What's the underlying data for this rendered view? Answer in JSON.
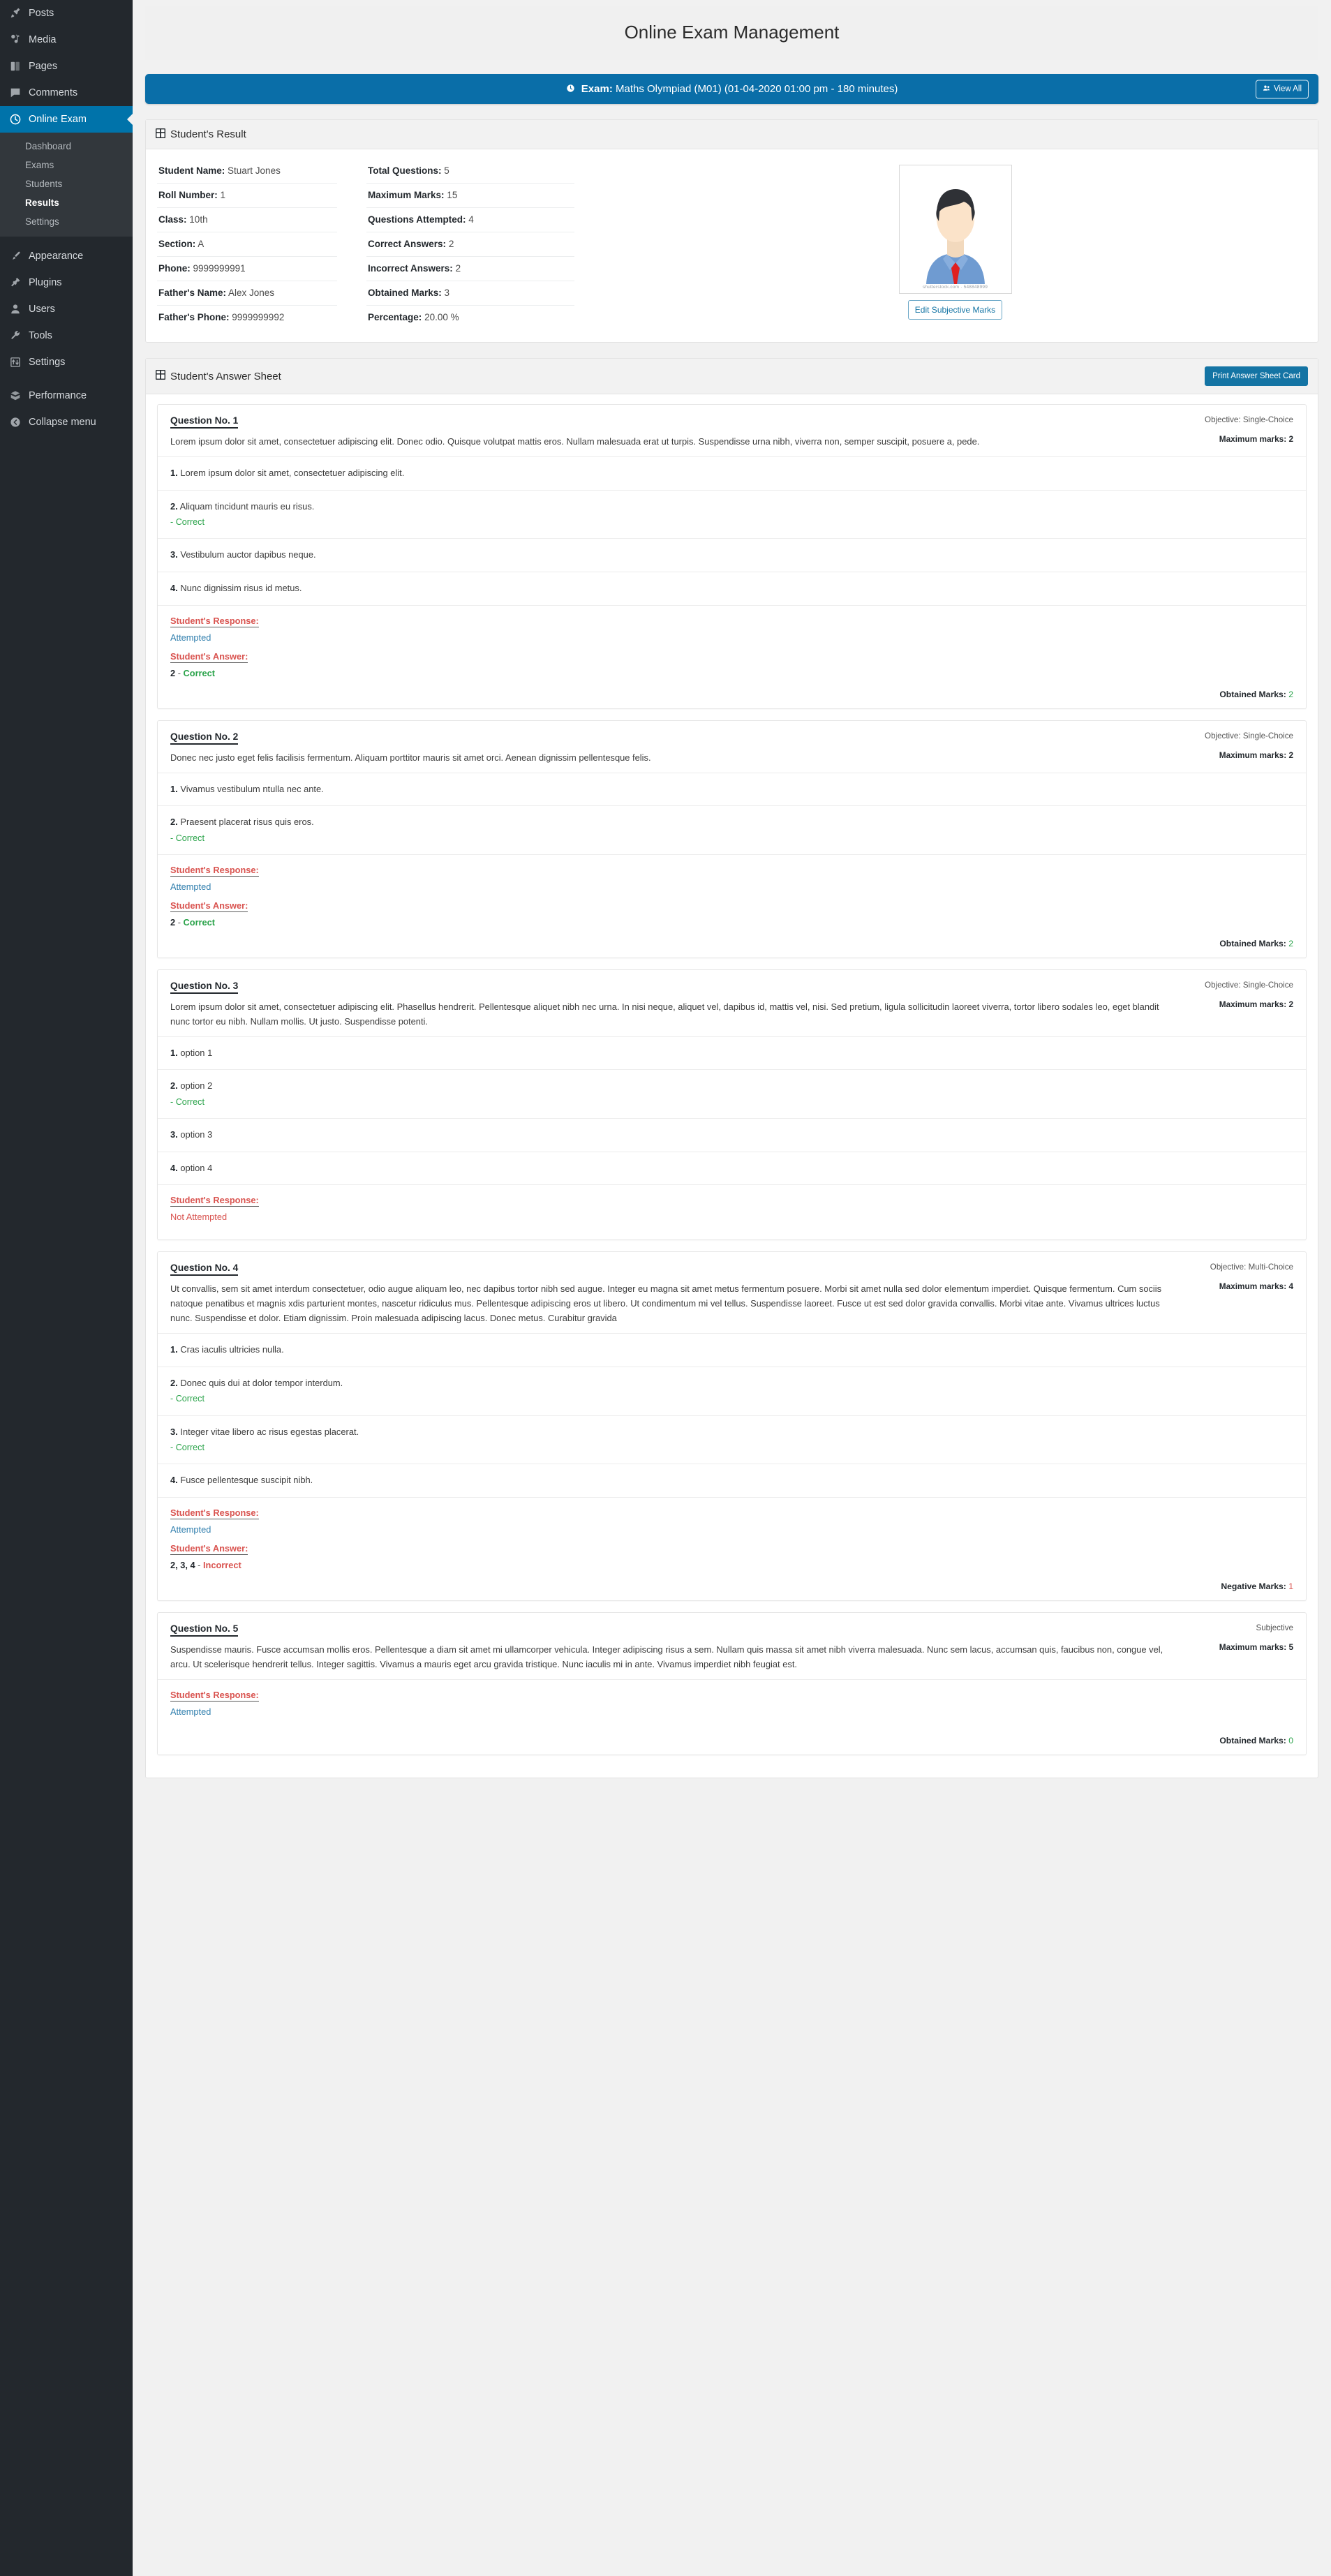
{
  "sidebar": {
    "items": [
      {
        "label": "Posts",
        "icon": "pin-icon"
      },
      {
        "label": "Media",
        "icon": "media-icon"
      },
      {
        "label": "Pages",
        "icon": "pages-icon"
      },
      {
        "label": "Comments",
        "icon": "comments-icon"
      },
      {
        "label": "Online Exam",
        "icon": "clock-icon"
      }
    ],
    "submenu": [
      {
        "label": "Dashboard"
      },
      {
        "label": "Exams"
      },
      {
        "label": "Students"
      },
      {
        "label": "Results"
      },
      {
        "label": "Settings"
      }
    ],
    "active_submenu": "Results",
    "items2": [
      {
        "label": "Appearance",
        "icon": "brush-icon"
      },
      {
        "label": "Plugins",
        "icon": "plug-icon"
      },
      {
        "label": "Users",
        "icon": "user-icon"
      },
      {
        "label": "Tools",
        "icon": "wrench-icon"
      },
      {
        "label": "Settings",
        "icon": "settings-icon"
      }
    ],
    "items3": [
      {
        "label": "Performance",
        "icon": "performance-icon"
      },
      {
        "label": "Collapse menu",
        "icon": "collapse-icon"
      }
    ]
  },
  "page": {
    "title": "Online Exam Management"
  },
  "exam_bar": {
    "label": "Exam:",
    "name": "Maths Olympiad (M01) (01-04-2020 01:00 pm - 180 minutes)",
    "view_all_label": "View All",
    "color": "#0a6ea8"
  },
  "result_panel": {
    "heading": "Student's Result",
    "left": [
      {
        "label": "Student Name:",
        "value": "Stuart Jones"
      },
      {
        "label": "Roll Number:",
        "value": "1"
      },
      {
        "label": "Class:",
        "value": "10th"
      },
      {
        "label": "Section:",
        "value": "A"
      },
      {
        "label": "Phone:",
        "value": "9999999991"
      },
      {
        "label": "Father's Name:",
        "value": "Alex Jones"
      },
      {
        "label": "Father's Phone:",
        "value": "9999999992"
      }
    ],
    "right": [
      {
        "label": "Total Questions:",
        "value": "5"
      },
      {
        "label": "Maximum Marks:",
        "value": "15"
      },
      {
        "label": "Questions Attempted:",
        "value": "4"
      },
      {
        "label": "Correct Answers:",
        "value": "2"
      },
      {
        "label": "Incorrect Answers:",
        "value": "2"
      },
      {
        "label": "Obtained Marks:",
        "value": "3"
      },
      {
        "label": "Percentage:",
        "value": "20.00 %"
      }
    ],
    "photo_watermark": "shutterstock.com · 548848999",
    "edit_subjective_label": "Edit Subjective Marks"
  },
  "answer_sheet": {
    "heading": "Student's Answer Sheet",
    "print_label": "Print Answer Sheet Card",
    "labels": {
      "maximum_marks": "Maximum marks:",
      "obtained_marks": "Obtained Marks:",
      "negative_marks": "Negative Marks:",
      "student_response": "Student's Response:",
      "student_answer": "Student's Answer:",
      "correct": "Correct",
      "dash": "-"
    },
    "questions": [
      {
        "no": "Question No. 1",
        "objective": "Objective: Single-Choice",
        "max_marks_label": "Maximum marks: 2",
        "text": "Lorem ipsum dolor sit amet, consectetuer adipiscing elit. Donec odio. Quisque volutpat mattis eros. Nullam malesuada erat ut turpis. Suspendisse urna nibh, viverra non, semper suscipit, posuere a, pede.",
        "options": [
          {
            "num": "1.",
            "text": "Lorem ipsum dolor sit amet, consectetuer adipiscing elit.",
            "correct": ""
          },
          {
            "num": "2.",
            "text": "Aliquam tincidunt mauris eu risus.",
            "correct": "- Correct"
          },
          {
            "num": "3.",
            "text": "Vestibulum auctor dapibus neque.",
            "correct": ""
          },
          {
            "num": "4.",
            "text": "Nunc dignissim risus id metus.",
            "correct": ""
          }
        ],
        "response_label": "Student's Response:",
        "response_value": "Attempted",
        "response_not_attempted": false,
        "answer_label": "Student's Answer:",
        "answer_value": "2",
        "answer_verdict": "Correct",
        "answer_verdict_type": "correct",
        "footer_label": "Obtained Marks:",
        "footer_value": "2",
        "footer_type": "obtained"
      },
      {
        "no": "Question No. 2",
        "objective": "Objective: Single-Choice",
        "max_marks_label": "Maximum marks: 2",
        "text": "Donec nec justo eget felis facilisis fermentum. Aliquam porttitor mauris sit amet orci. Aenean dignissim pellentesque felis.",
        "options": [
          {
            "num": "1.",
            "text": "Vivamus vestibulum ntulla nec ante.",
            "correct": ""
          },
          {
            "num": "2.",
            "text": "Praesent placerat risus quis eros.",
            "correct": "- Correct"
          }
        ],
        "response_label": "Student's Response:",
        "response_value": "Attempted",
        "response_not_attempted": false,
        "answer_label": "Student's Answer:",
        "answer_value": "2",
        "answer_verdict": "Correct",
        "answer_verdict_type": "correct",
        "footer_label": "Obtained Marks:",
        "footer_value": "2",
        "footer_type": "obtained"
      },
      {
        "no": "Question No. 3",
        "objective": "Objective: Single-Choice",
        "max_marks_label": "Maximum marks: 2",
        "text": "Lorem ipsum dolor sit amet, consectetuer adipiscing elit. Phasellus hendrerit. Pellentesque aliquet nibh nec urna. In nisi neque, aliquet vel, dapibus id, mattis vel, nisi. Sed pretium, ligula sollicitudin laoreet viverra, tortor libero sodales leo, eget blandit nunc tortor eu nibh. Nullam mollis. Ut justo. Suspendisse potenti.",
        "options": [
          {
            "num": "1.",
            "text": "option 1",
            "correct": ""
          },
          {
            "num": "2.",
            "text": "option 2",
            "correct": "- Correct"
          },
          {
            "num": "3.",
            "text": "option 3",
            "correct": ""
          },
          {
            "num": "4.",
            "text": "option 4",
            "correct": ""
          }
        ],
        "response_label": "Student's Response:",
        "response_value": "Not Attempted",
        "response_not_attempted": true,
        "answer_label": "",
        "answer_value": "",
        "answer_verdict": "",
        "answer_verdict_type": "",
        "footer_label": "",
        "footer_value": "",
        "footer_type": "none"
      },
      {
        "no": "Question No. 4",
        "objective": "Objective: Multi-Choice",
        "max_marks_label": "Maximum marks: 4",
        "text": "Ut convallis, sem sit amet interdum consectetuer, odio augue aliquam leo, nec dapibus tortor nibh sed augue. Integer eu magna sit amet metus fermentum posuere. Morbi sit amet nulla sed dolor elementum imperdiet. Quisque fermentum. Cum sociis natoque penatibus et magnis xdis parturient montes, nascetur ridiculus mus. Pellentesque adipiscing eros ut libero. Ut condimentum mi vel tellus. Suspendisse laoreet. Fusce ut est sed dolor gravida convallis. Morbi vitae ante. Vivamus ultrices luctus nunc. Suspendisse et dolor. Etiam dignissim. Proin malesuada adipiscing lacus. Donec metus. Curabitur gravida",
        "options": [
          {
            "num": "1.",
            "text": "Cras iaculis ultricies nulla.",
            "correct": ""
          },
          {
            "num": "2.",
            "text": "Donec quis dui at dolor tempor interdum.",
            "correct": "- Correct"
          },
          {
            "num": "3.",
            "text": "Integer vitae libero ac risus egestas placerat.",
            "correct": "- Correct"
          },
          {
            "num": "4.",
            "text": "Fusce pellentesque suscipit nibh.",
            "correct": ""
          }
        ],
        "response_label": "Student's Response:",
        "response_value": "Attempted",
        "response_not_attempted": false,
        "answer_label": "Student's Answer:",
        "answer_value": "2, 3, 4",
        "answer_verdict": "Incorrect",
        "answer_verdict_type": "incorrect",
        "footer_label": "Negative Marks:",
        "footer_value": "1",
        "footer_type": "negative"
      },
      {
        "no": "Question No. 5",
        "objective": "Subjective",
        "max_marks_label": "Maximum marks: 5",
        "text": "Suspendisse mauris. Fusce accumsan mollis eros. Pellentesque a diam sit amet mi ullamcorper vehicula. Integer adipiscing risus a sem. Nullam quis massa sit amet nibh viverra malesuada. Nunc sem lacus, accumsan quis, faucibus non, congue vel, arcu. Ut scelerisque hendrerit tellus. Integer sagittis. Vivamus a mauris eget arcu gravida tristique. Nunc iaculis mi in ante. Vivamus imperdiet nibh feugiat est.",
        "options": [],
        "response_label": "Student's Response:",
        "response_value": "Attempted",
        "response_not_attempted": false,
        "answer_label": "",
        "answer_value": "",
        "answer_verdict": "",
        "answer_verdict_type": "",
        "footer_label": "Obtained Marks:",
        "footer_value": "0",
        "footer_type": "obtained"
      }
    ]
  }
}
